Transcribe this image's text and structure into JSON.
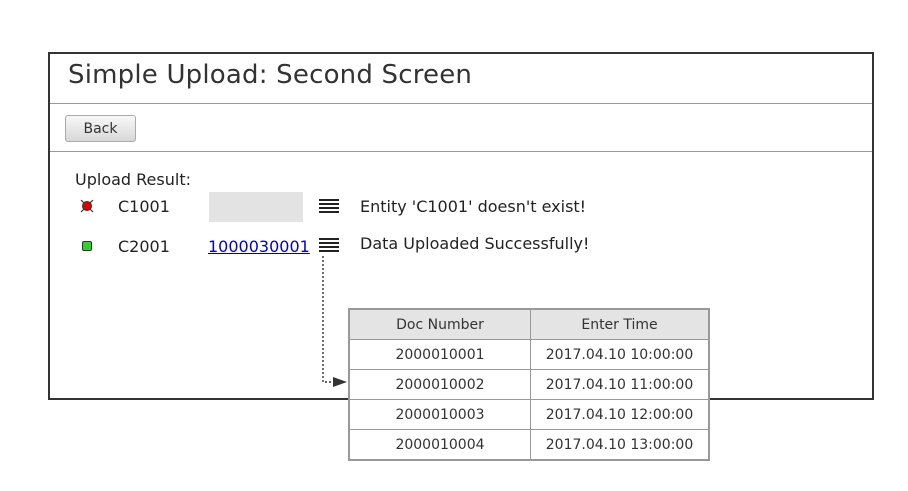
{
  "window": {
    "title": "Simple Upload: Second Screen"
  },
  "toolbar": {
    "back_label": "Back"
  },
  "upload": {
    "result_label": "Upload Result:",
    "rows": [
      {
        "status": "error",
        "status_color": "#e30000",
        "entity": "C1001",
        "doc_number": "",
        "message": "Entity 'C1001' doesn't exist!"
      },
      {
        "status": "success",
        "status_color": "#2bd32b",
        "entity": "C2001",
        "doc_number": "1000030001",
        "message": "Data Uploaded Successfully!"
      }
    ]
  },
  "details_table": {
    "headers": [
      "Doc Number",
      "Enter Time"
    ],
    "rows": [
      [
        "2000010001",
        "2017.04.10 10:00:00"
      ],
      [
        "2000010002",
        "2017.04.10 11:00:00"
      ],
      [
        "2000010003",
        "2017.04.10 12:00:00"
      ],
      [
        "2000010004",
        "2017.04.10 13:00:00"
      ]
    ]
  },
  "icons": {
    "status_error": "error-status-icon",
    "status_success": "success-status-icon",
    "detail": "list-detail-icon",
    "connector": "dotted-arrow-connector"
  }
}
